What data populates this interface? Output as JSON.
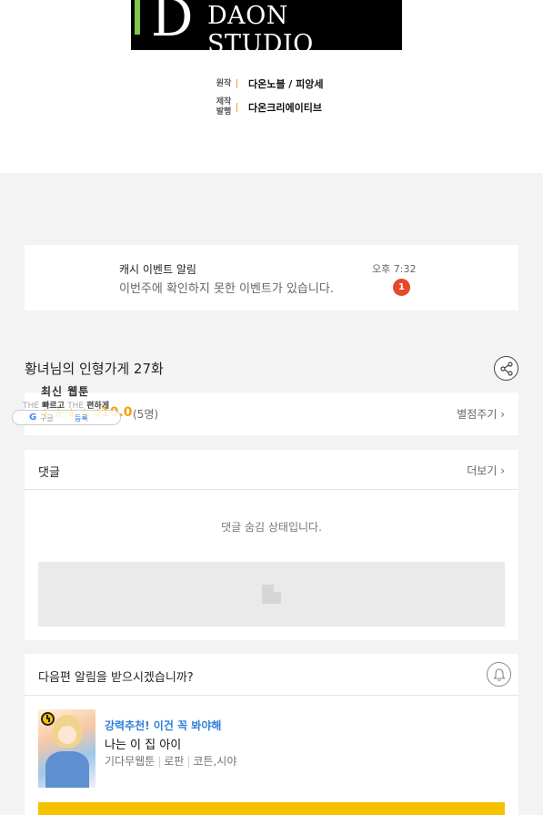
{
  "banner": {
    "logo_letter": "D",
    "studio": "DAON STUDIO",
    "accent": "#7ec64a"
  },
  "credits": [
    {
      "key": "원작",
      "value": "다온노블 / 피앙세"
    },
    {
      "key": "제작발행",
      "value": "다온크리에이티브"
    }
  ],
  "notice": {
    "title": "캐시 이벤트 알림",
    "message": "이번주에 확인하지 못한 이벤트가 있습니다.",
    "time": "오후 7:32",
    "badge": "1",
    "badge_color": "#e5492b"
  },
  "episode": {
    "title": "황녀님의 인형가게 27화",
    "share_icon": "share-icon"
  },
  "rating": {
    "stars": "★★★★★",
    "score": "10.0",
    "count": "(5명)",
    "rate_link": "별점주기 ›",
    "star_color": "#f5b400"
  },
  "overlay": {
    "title": "최신 웹툰",
    "sub_faint_1": "THE",
    "sub_bold_1": "빠르고",
    "sub_faint_2": "THE",
    "sub_bold_2": "편하게",
    "google_label": "구글",
    "play_label": "등록"
  },
  "comments": {
    "label": "댓글",
    "more": "더보기 ›",
    "hidden_message": "댓글 숨김 상태입니다."
  },
  "subscribe": {
    "question": "다음편 알림을 받으시겠습니까?",
    "bell_icon": "bell-icon"
  },
  "recommend": {
    "tag": "강력추천! 이건 꼭 봐야해",
    "title": "나는 이 집 아이",
    "meta": [
      "기다무웹툰",
      "로판",
      "코튼,시야"
    ],
    "tag_color": "#2f7fd8",
    "button_color": "#f5c200"
  }
}
